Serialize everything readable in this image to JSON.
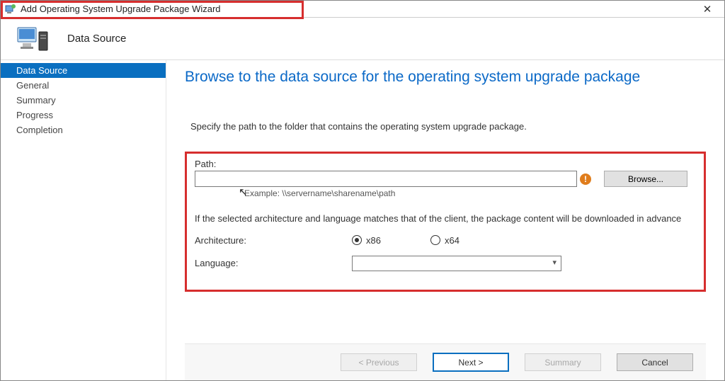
{
  "window": {
    "title": "Add Operating System Upgrade Package Wizard",
    "close_glyph": "✕"
  },
  "header": {
    "title": "Data Source"
  },
  "sidebar": {
    "items": [
      {
        "label": "Data Source",
        "active": true
      },
      {
        "label": "General",
        "active": false
      },
      {
        "label": "Summary",
        "active": false
      },
      {
        "label": "Progress",
        "active": false
      },
      {
        "label": "Completion",
        "active": false
      }
    ]
  },
  "main": {
    "heading": "Browse to the data source for the operating system upgrade package",
    "instruction": "Specify the path to the folder that contains the operating system upgrade package.",
    "path_label": "Path:",
    "path_value": "",
    "example": "Example: \\\\servername\\sharename\\path",
    "browse_label": "Browse...",
    "error_glyph": "!",
    "note": "If the selected architecture and language matches that of the client, the package content will be downloaded in advance",
    "architecture_label": "Architecture:",
    "arch_options": {
      "x86": "x86",
      "x64": "x64"
    },
    "arch_selected": "x86",
    "language_label": "Language:",
    "language_value": ""
  },
  "footer": {
    "previous": "< Previous",
    "next": "Next >",
    "summary": "Summary",
    "cancel": "Cancel"
  }
}
